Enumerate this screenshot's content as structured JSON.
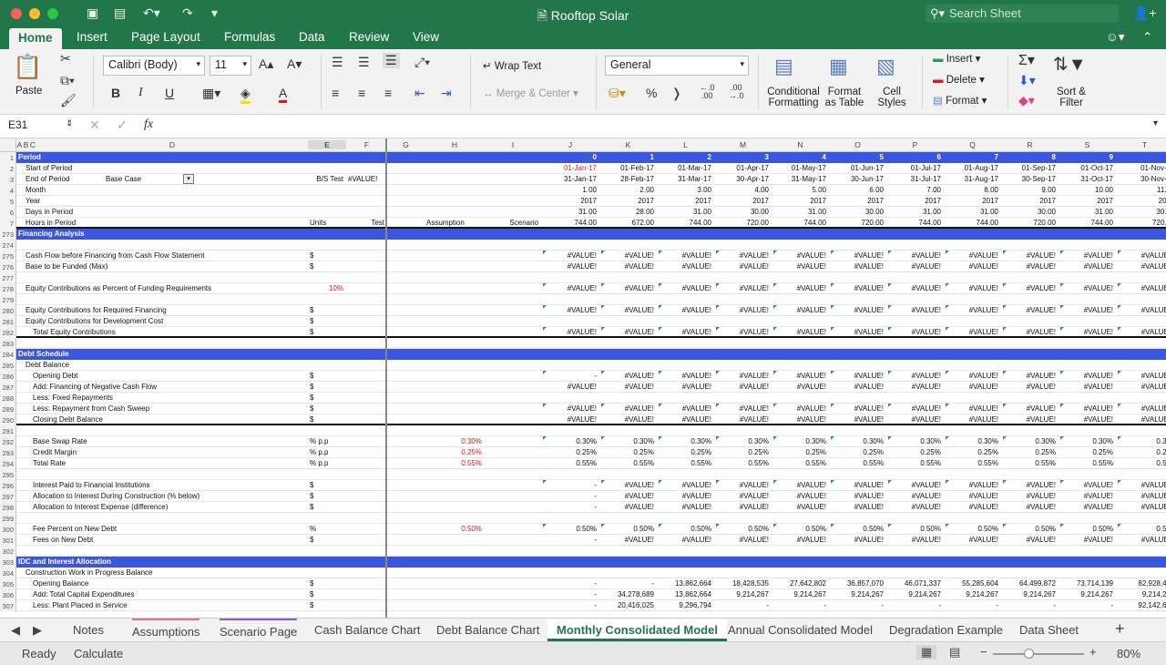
{
  "window": {
    "title": "Rooftop Solar",
    "search_placeholder": "Search Sheet"
  },
  "ribbon_tabs": [
    "Home",
    "Insert",
    "Page Layout",
    "Formulas",
    "Data",
    "Review",
    "View"
  ],
  "ribbon": {
    "paste": "Paste",
    "font_name": "Calibri (Body)",
    "font_size": "11",
    "bold": "B",
    "italic": "I",
    "underline": "U",
    "wrap_text": "Wrap Text",
    "merge_center": "Merge & Center",
    "number_format": "General",
    "percent": "%",
    "comma": "❭",
    "conditional_formatting": "Conditional Formatting",
    "format_as_table": "Format as Table",
    "cell_styles": "Cell Styles",
    "insert": "Insert",
    "delete": "Delete",
    "format": "Format",
    "sort_filter": "Sort & Filter"
  },
  "formula_bar": {
    "name_box": "E31",
    "fx": "fx",
    "formula": ""
  },
  "columns": [
    "A",
    "B",
    "C",
    "D",
    "E",
    "F",
    "G",
    "H",
    "I",
    "J",
    "K",
    "L",
    "M",
    "N",
    "O",
    "P",
    "Q",
    "R",
    "S",
    "T"
  ],
  "period_columns": [
    "0",
    "1",
    "2",
    "3",
    "4",
    "5",
    "6",
    "7",
    "8",
    "9",
    "1"
  ],
  "rows": [
    {
      "n": "1",
      "kind": "header",
      "d": "Period",
      "vals": [
        "0",
        "1",
        "2",
        "3",
        "4",
        "5",
        "6",
        "7",
        "8",
        "9",
        "1"
      ]
    },
    {
      "n": "2",
      "d": "Start of Period",
      "vals": [
        "01-Jan-17",
        "01-Feb-17",
        "01-Mar-17",
        "01-Apr-17",
        "01-May-17",
        "01-Jun-17",
        "01-Jul-17",
        "01-Aug-17",
        "01-Sep-17",
        "01-Oct-17",
        "01-Nov-1"
      ],
      "first_red": true
    },
    {
      "n": "3",
      "d": "End of Period",
      "extra": "Base Case",
      "e": "B/S Test",
      "f": "#VALUE!",
      "vals": [
        "31-Jan-17",
        "28-Feb-17",
        "31-Mar-17",
        "30-Apr-17",
        "31-May-17",
        "30-Jun-17",
        "31-Jul-17",
        "31-Aug-17",
        "30-Sep-17",
        "31-Oct-17",
        "30-Nov-1"
      ]
    },
    {
      "n": "4",
      "d": "Month",
      "vals": [
        "1.00",
        "2.00",
        "3.00",
        "4.00",
        "5.00",
        "6.00",
        "7.00",
        "8.00",
        "9.00",
        "10.00",
        "11.0"
      ]
    },
    {
      "n": "5",
      "d": "Year",
      "vals": [
        "2017",
        "2017",
        "2017",
        "2017",
        "2017",
        "2017",
        "2017",
        "2017",
        "2017",
        "2017",
        "201"
      ]
    },
    {
      "n": "6",
      "d": "Days in Period",
      "vals": [
        "31.00",
        "28.00",
        "31.00",
        "30.00",
        "31.00",
        "30.00",
        "31.00",
        "31.00",
        "30.00",
        "31.00",
        "30.0"
      ]
    },
    {
      "n": "7",
      "d": "Hours in Period",
      "e": "Units",
      "f": "Test",
      "h": "Assumption",
      "i": "Scenario",
      "vals": [
        "744.00",
        "672.00",
        "744.00",
        "720.00",
        "744.00",
        "720.00",
        "744.00",
        "744.00",
        "720.00",
        "744.00",
        "720.0"
      ],
      "thick": true
    },
    {
      "n": "273",
      "kind": "header",
      "d": "Financing Analysis"
    },
    {
      "n": "274"
    },
    {
      "n": "275",
      "d": "Cash Flow before Financing from Cash Flow Statement",
      "indent": 1,
      "e": "$",
      "vals": [
        "#VALUE!",
        "#VALUE!",
        "#VALUE!",
        "#VALUE!",
        "#VALUE!",
        "#VALUE!",
        "#VALUE!",
        "#VALUE!",
        "#VALUE!",
        "#VALUE!",
        "#VALUE!"
      ],
      "ticks": true
    },
    {
      "n": "276",
      "d": "Base to be Funded (Max)",
      "indent": 1,
      "e": "$",
      "vals": [
        "#VALUE!",
        "#VALUE!",
        "#VALUE!",
        "#VALUE!",
        "#VALUE!",
        "#VALUE!",
        "#VALUE!",
        "#VALUE!",
        "#VALUE!",
        "#VALUE!",
        "#VALUE!"
      ]
    },
    {
      "n": "277"
    },
    {
      "n": "278",
      "d": "Equity Contributions as Percent of Funding Requirements",
      "indent": 1,
      "e_red": "10%",
      "vals": [
        "#VALUE!",
        "#VALUE!",
        "#VALUE!",
        "#VALUE!",
        "#VALUE!",
        "#VALUE!",
        "#VALUE!",
        "#VALUE!",
        "#VALUE!",
        "#VALUE!",
        "#VALUE!"
      ],
      "ticks": true
    },
    {
      "n": "279"
    },
    {
      "n": "280",
      "d": "Equity Contributions for Required Financing",
      "indent": 1,
      "e": "$",
      "vals": [
        "#VALUE!",
        "#VALUE!",
        "#VALUE!",
        "#VALUE!",
        "#VALUE!",
        "#VALUE!",
        "#VALUE!",
        "#VALUE!",
        "#VALUE!",
        "#VALUE!",
        "#VALUE!"
      ],
      "ticks": true
    },
    {
      "n": "281",
      "d": "Equity Contributions for Development Cost",
      "indent": 1,
      "e": "$"
    },
    {
      "n": "282",
      "d": "Total Equity Contributions",
      "indent": 2,
      "e": "$",
      "vals": [
        "#VALUE!",
        "#VALUE!",
        "#VALUE!",
        "#VALUE!",
        "#VALUE!",
        "#VALUE!",
        "#VALUE!",
        "#VALUE!",
        "#VALUE!",
        "#VALUE!",
        "#VALUE!"
      ],
      "thick": true,
      "ticks": true
    },
    {
      "n": "283"
    },
    {
      "n": "284",
      "kind": "header",
      "d": "Debt Schedule"
    },
    {
      "n": "285",
      "d": "Debt Balance",
      "indent": 1
    },
    {
      "n": "286",
      "d": "Opening Debt",
      "indent": 2,
      "e": "$",
      "vals": [
        "-",
        "#VALUE!",
        "#VALUE!",
        "#VALUE!",
        "#VALUE!",
        "#VALUE!",
        "#VALUE!",
        "#VALUE!",
        "#VALUE!",
        "#VALUE!",
        "#VALUE!"
      ],
      "ticks": true
    },
    {
      "n": "287",
      "d": "Add: Financing of Negative Cash Flow",
      "indent": 2,
      "e": "$",
      "vals": [
        "#VALUE!",
        "#VALUE!",
        "#VALUE!",
        "#VALUE!",
        "#VALUE!",
        "#VALUE!",
        "#VALUE!",
        "#VALUE!",
        "#VALUE!",
        "#VALUE!",
        "#VALUE!"
      ]
    },
    {
      "n": "288",
      "d": "Less: Fixed Repayments",
      "indent": 2,
      "e": "$"
    },
    {
      "n": "289",
      "d": "Less: Repayment from Cash Sweep",
      "indent": 2,
      "e": "$",
      "vals": [
        "#VALUE!",
        "#VALUE!",
        "#VALUE!",
        "#VALUE!",
        "#VALUE!",
        "#VALUE!",
        "#VALUE!",
        "#VALUE!",
        "#VALUE!",
        "#VALUE!",
        "#VALUE!"
      ],
      "ticks": true
    },
    {
      "n": "290",
      "d": "Closing Debt Balance",
      "indent": 2,
      "e": "$",
      "vals": [
        "#VALUE!",
        "#VALUE!",
        "#VALUE!",
        "#VALUE!",
        "#VALUE!",
        "#VALUE!",
        "#VALUE!",
        "#VALUE!",
        "#VALUE!",
        "#VALUE!",
        "#VALUE!"
      ],
      "thick": true
    },
    {
      "n": "291"
    },
    {
      "n": "292",
      "d": "Base Swap Rate",
      "indent": 2,
      "e": "% p.p",
      "h_red": "0.30%",
      "vals": [
        "0.30%",
        "0.30%",
        "0.30%",
        "0.30%",
        "0.30%",
        "0.30%",
        "0.30%",
        "0.30%",
        "0.30%",
        "0.30%",
        "0.30"
      ],
      "ticks": true
    },
    {
      "n": "293",
      "d": "Credit Margin",
      "indent": 2,
      "e": "% p.p",
      "h_red": "0.25%",
      "vals": [
        "0.25%",
        "0.25%",
        "0.25%",
        "0.25%",
        "0.25%",
        "0.25%",
        "0.25%",
        "0.25%",
        "0.25%",
        "0.25%",
        "0.25"
      ]
    },
    {
      "n": "294",
      "d": "Total Rate",
      "indent": 2,
      "e": "% p.p",
      "h_red": "0.55%",
      "vals": [
        "0.55%",
        "0.55%",
        "0.55%",
        "0.55%",
        "0.55%",
        "0.55%",
        "0.55%",
        "0.55%",
        "0.55%",
        "0.55%",
        "0.55"
      ]
    },
    {
      "n": "295"
    },
    {
      "n": "296",
      "d": "Interest Paid to Financial Institutions",
      "indent": 2,
      "e": "$",
      "vals": [
        "-",
        "#VALUE!",
        "#VALUE!",
        "#VALUE!",
        "#VALUE!",
        "#VALUE!",
        "#VALUE!",
        "#VALUE!",
        "#VALUE!",
        "#VALUE!",
        "#VALUE!"
      ],
      "ticks": true
    },
    {
      "n": "297",
      "d": "Allocation to Interest During Construction (% below)",
      "indent": 2,
      "e": "$",
      "vals": [
        "-",
        "#VALUE!",
        "#VALUE!",
        "#VALUE!",
        "#VALUE!",
        "#VALUE!",
        "#VALUE!",
        "#VALUE!",
        "#VALUE!",
        "#VALUE!",
        "#VALUE!"
      ]
    },
    {
      "n": "298",
      "d": "Allocation to Interest Expense (difference)",
      "indent": 2,
      "e": "$",
      "vals": [
        "-",
        "#VALUE!",
        "#VALUE!",
        "#VALUE!",
        "#VALUE!",
        "#VALUE!",
        "#VALUE!",
        "#VALUE!",
        "#VALUE!",
        "#VALUE!",
        "#VALUE!"
      ]
    },
    {
      "n": "299"
    },
    {
      "n": "300",
      "d": "Fee Percent on New Debt",
      "indent": 2,
      "e": "%",
      "h_red": "0.50%",
      "vals": [
        "0.50%",
        "0.50%",
        "0.50%",
        "0.50%",
        "0.50%",
        "0.50%",
        "0.50%",
        "0.50%",
        "0.50%",
        "0.50%",
        "0.50"
      ],
      "ticks": true
    },
    {
      "n": "301",
      "d": "Fees on New Debt",
      "indent": 2,
      "e": "$",
      "vals": [
        "-",
        "#VALUE!",
        "#VALUE!",
        "#VALUE!",
        "#VALUE!",
        "#VALUE!",
        "#VALUE!",
        "#VALUE!",
        "#VALUE!",
        "#VALUE!",
        "#VALUE!"
      ]
    },
    {
      "n": "302"
    },
    {
      "n": "303",
      "kind": "header",
      "d": "IDC and Interest Allocation"
    },
    {
      "n": "304",
      "d": "Construction Work in Progress Balance",
      "indent": 1
    },
    {
      "n": "305",
      "d": "Opening Balance",
      "indent": 2,
      "e": "$",
      "vals": [
        "-",
        "-",
        "13,862,664",
        "18,428,535",
        "27,642,802",
        "36,857,070",
        "46,071,337",
        "55,285,604",
        "64,499,872",
        "73,714,139",
        "82,928,40"
      ]
    },
    {
      "n": "306",
      "d": "Add: Total Capital Expenditures",
      "indent": 2,
      "e": "$",
      "vals": [
        "-",
        "34,278,689",
        "13,862,664",
        "9,214,267",
        "9,214,267",
        "9,214,267",
        "9,214,267",
        "9,214,267",
        "9,214,267",
        "9,214,267",
        "9,214,26"
      ]
    },
    {
      "n": "307",
      "d": "Less: Plant Placed in Service",
      "indent": 2,
      "e": "$",
      "vals": [
        "-",
        "20,416,025",
        "9,296,794",
        "-",
        "-",
        "-",
        "-",
        "-",
        "-",
        "-",
        "92,142,67"
      ]
    }
  ],
  "sheet_tabs": [
    "Notes",
    "Assumptions",
    "Scenario Page",
    "Cash Balance Chart",
    "Debt Balance Chart",
    "Monthly Consolidated Model",
    "Annual Consolidated Model",
    "Degradation Example",
    "Data Sheet"
  ],
  "active_sheet": "Monthly Consolidated Model",
  "status": {
    "ready": "Ready",
    "calculate": "Calculate",
    "zoom": "80%"
  }
}
